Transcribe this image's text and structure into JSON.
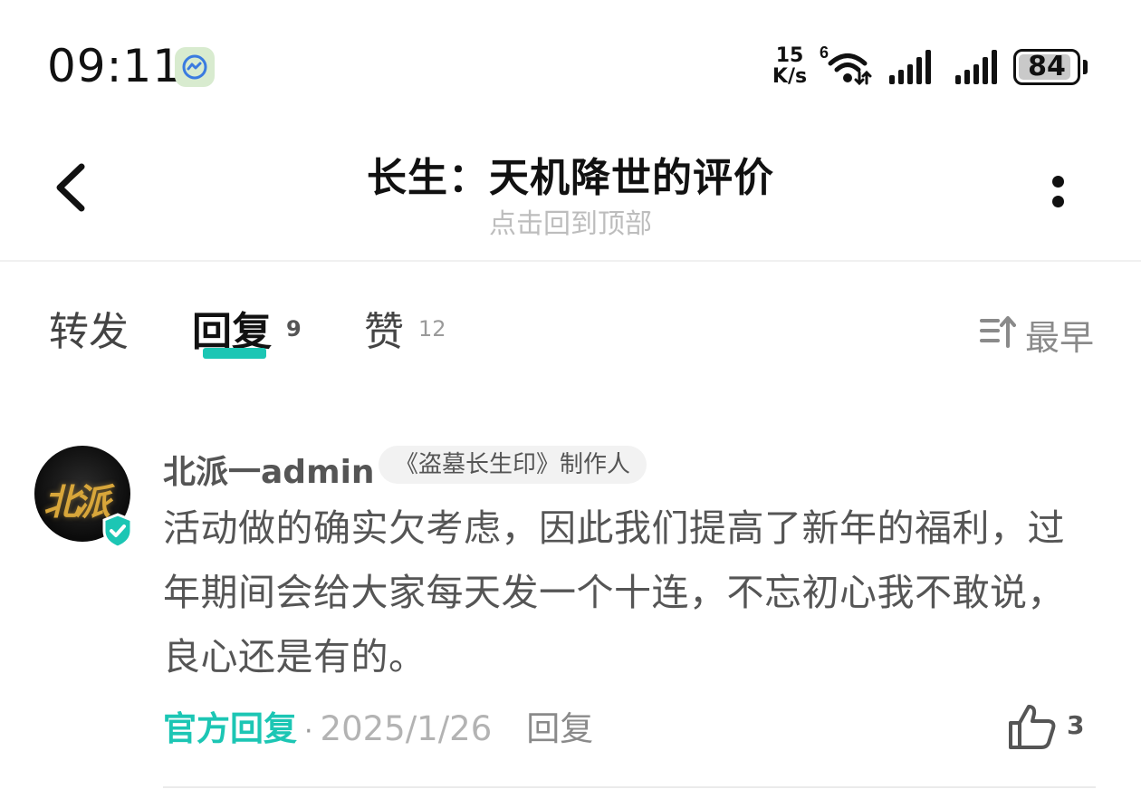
{
  "status_bar": {
    "time": "09:11",
    "net_speed_value": "15",
    "net_speed_unit": "K/s",
    "battery_level": "84"
  },
  "header": {
    "title": "长生：天机降世的评价",
    "subtitle": "点击回到顶部"
  },
  "tabs": [
    {
      "label": "转发",
      "count": ""
    },
    {
      "label": "回复",
      "count": "9"
    },
    {
      "label": "赞",
      "count": "12"
    }
  ],
  "sort": {
    "label": "最早"
  },
  "comment": {
    "username": "北派一admin",
    "user_tag": "《盗墓长生印》制作人",
    "avatar_text": "北派",
    "body": "活动做的确实欠考虑，因此我们提高了新年的福利，过年期间会给大家每天发一个十连，不忘初心我不敢说，良心还是有的。",
    "official_label": "官方回复",
    "date": "2025/1/26",
    "reply_label": "回复",
    "like_count": "3"
  },
  "colors": {
    "accent": "#1cc6b4",
    "text_primary": "#111111",
    "text_secondary": "#555555",
    "text_muted": "#b3b3b3"
  }
}
